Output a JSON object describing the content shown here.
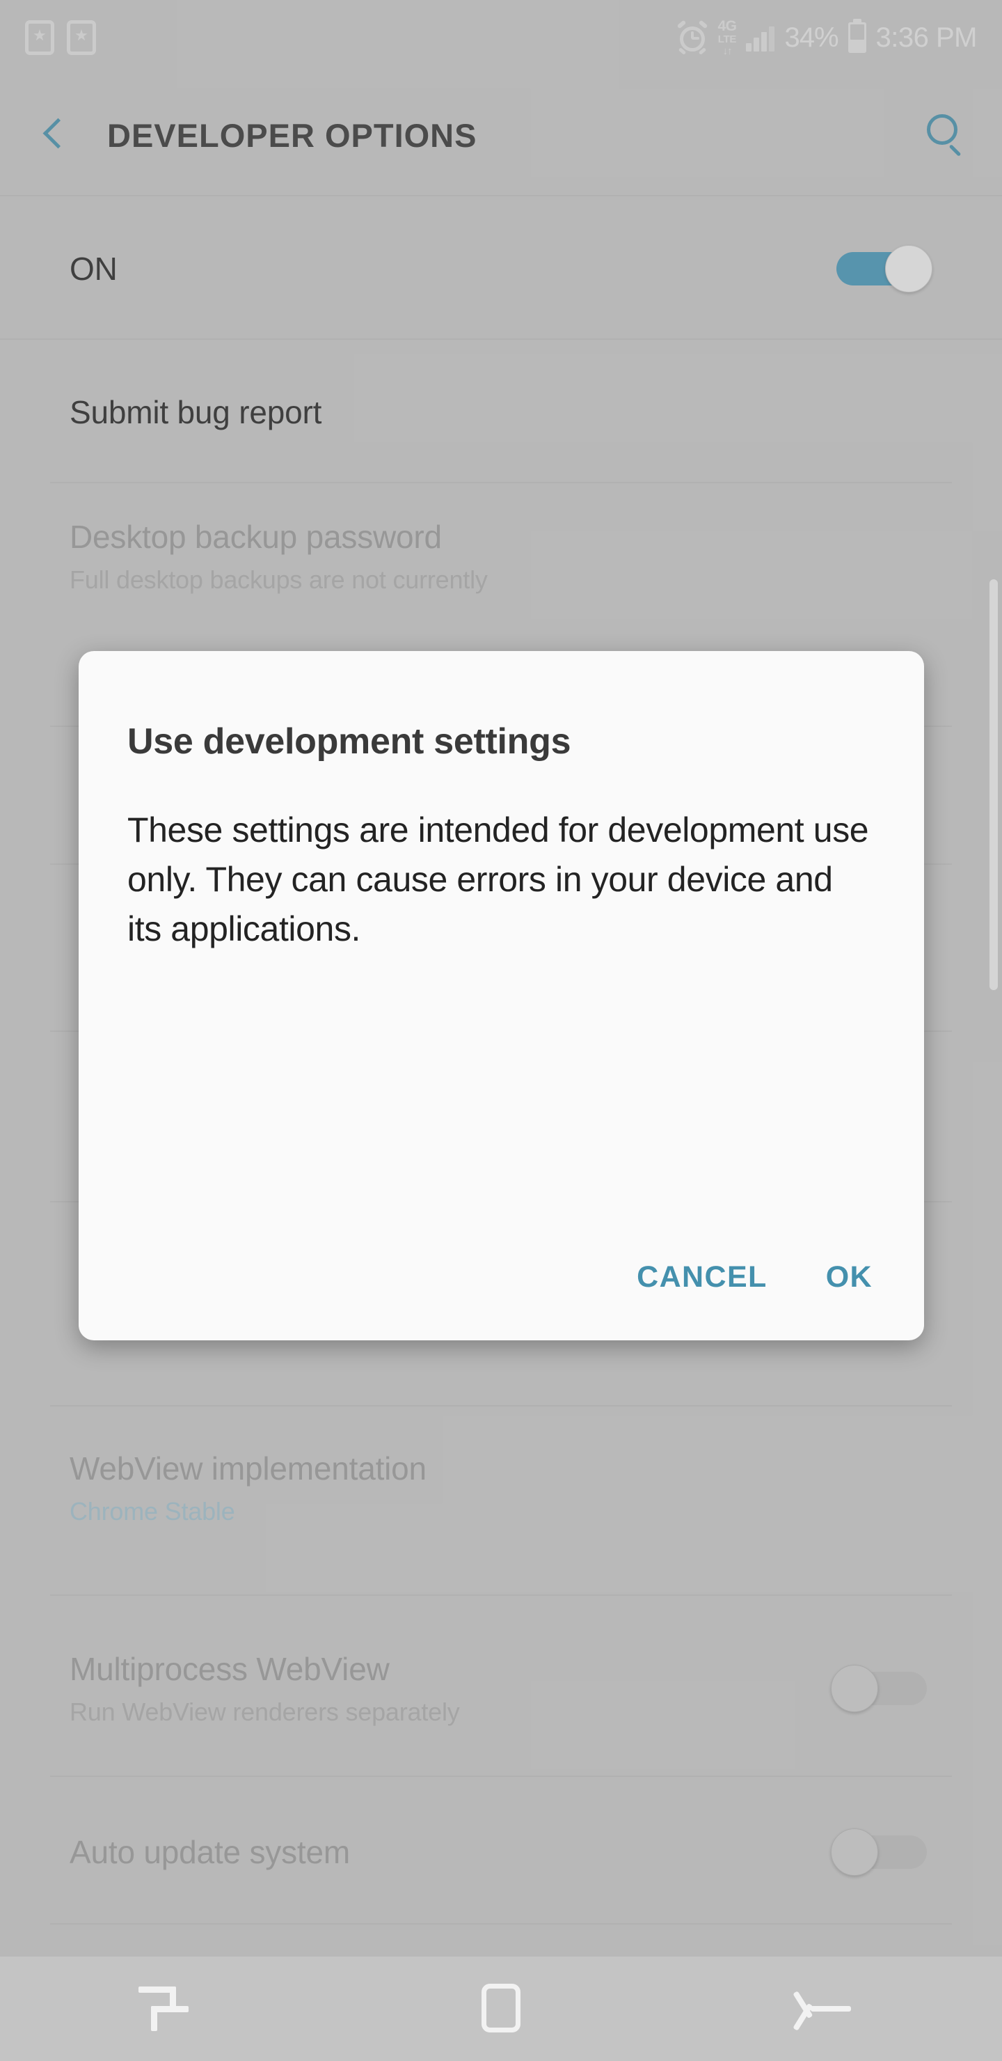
{
  "status_bar": {
    "notification_icons": [
      "bookmark-icon",
      "bookmark-icon"
    ],
    "alarm_icon": "alarm-icon",
    "network_label_top": "4G",
    "network_label_bottom": "LTE",
    "network_arrows": "↓↑",
    "signal_icon": "signal-bars-icon",
    "battery_percent": "34%",
    "battery_icon": "battery-icon",
    "time": "3:36 PM"
  },
  "app_bar": {
    "back_icon": "back-chevron-icon",
    "title": "DEVELOPER OPTIONS",
    "search_icon": "search-icon"
  },
  "master_switch": {
    "label": "ON",
    "state": "on"
  },
  "settings_rows": [
    {
      "title": "Submit bug report",
      "subtitle": "",
      "control": "none",
      "emphasis": "strong"
    },
    {
      "title": "Desktop backup password",
      "subtitle": "Full desktop backups are not currently",
      "control": "none",
      "emphasis": "normal"
    },
    {
      "title": "WebView implementation",
      "subtitle": "Chrome Stable",
      "control": "none",
      "emphasis": "normal",
      "subtitle_style": "link"
    },
    {
      "title": "Multiprocess WebView",
      "subtitle": "Run WebView renderers separately",
      "control": "toggle",
      "toggle_state": "off",
      "emphasis": "normal"
    },
    {
      "title": "Auto update system",
      "subtitle": "",
      "control": "toggle",
      "toggle_state": "off",
      "emphasis": "normal"
    }
  ],
  "dialog": {
    "title": "Use development settings",
    "message": "These settings are intended for development use only. They can cause errors in your device and its applications.",
    "cancel_label": "CANCEL",
    "ok_label": "OK"
  },
  "nav_bar": {
    "recents_icon": "recents-icon",
    "home_icon": "home-icon",
    "back_icon": "back-arrow-icon"
  },
  "colors": {
    "accent": "#3d8fad",
    "dialog_button": "#4490ad",
    "toggle_on": "#3d94b8",
    "background": "#c8c8c8",
    "dialog_background": "#fafafa",
    "link_subtitle": "#9fc0cf"
  }
}
